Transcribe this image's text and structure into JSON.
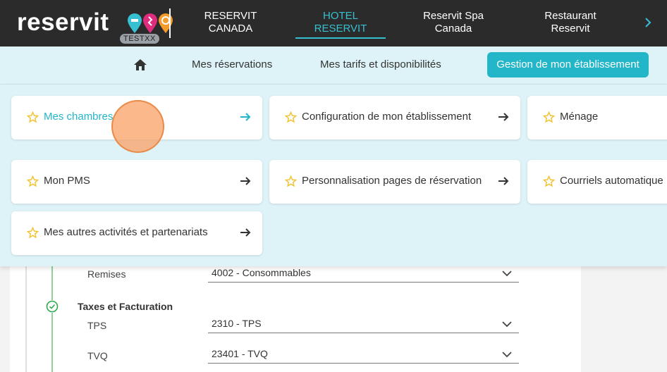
{
  "app": {
    "logo_text": "reservit",
    "environment_badge": "TESTXX"
  },
  "top_nav": {
    "items": [
      {
        "label": "RESERVIT CANADA",
        "active": false
      },
      {
        "label": "HOTEL RESERVIT",
        "active": true
      },
      {
        "label": "Reservit Spa Canada",
        "active": false
      },
      {
        "label": "Restaurant Reservit",
        "active": false
      }
    ],
    "next_icon": "chevron-right-icon"
  },
  "sub_nav": {
    "home_icon": "home-icon",
    "links": [
      "Mes réservations",
      "Mes tarifs et disponibilités"
    ],
    "active_button": "Gestion de mon établissement"
  },
  "menu_cards": [
    {
      "label": "Mes chambres",
      "highlighted": true
    },
    {
      "label": "Configuration de mon établissement",
      "highlighted": false
    },
    {
      "label": "Ménage",
      "highlighted": false
    },
    {
      "label": "Mon PMS",
      "highlighted": false
    },
    {
      "label": "Personnalisation pages de réservation",
      "highlighted": false
    },
    {
      "label": "Courriels automatique",
      "highlighted": false
    },
    {
      "label": "Mes autres activités et partenariats",
      "highlighted": false
    }
  ],
  "form": {
    "remises": {
      "label": "Remises",
      "value": "4002 - Consommables"
    },
    "section_title": "Taxes et Facturation",
    "tps": {
      "label": "TPS",
      "value": "2310 - TPS"
    },
    "tvq": {
      "label": "TVQ",
      "value": "23401 - TVQ"
    }
  },
  "colors": {
    "topbar": "#2b2b2b",
    "accent": "#23b6c9",
    "subnav_bg": "#def3f8",
    "star": "#f2c12e",
    "success": "#2ea84a"
  }
}
